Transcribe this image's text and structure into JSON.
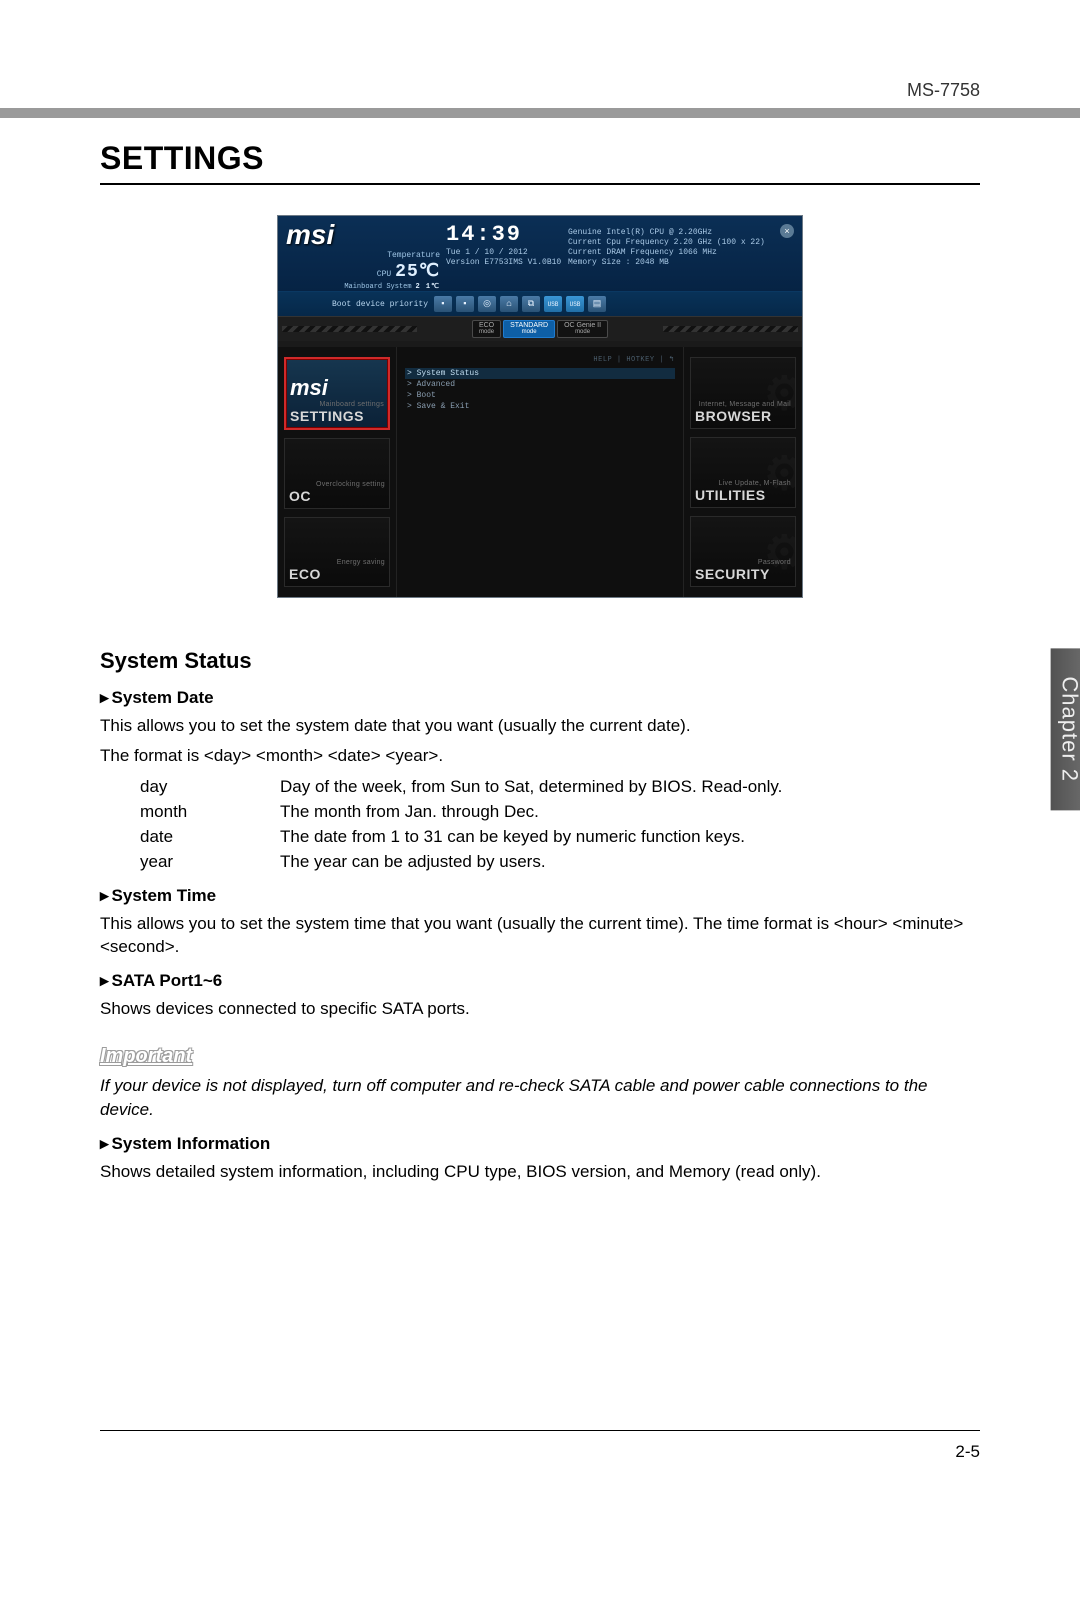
{
  "header": {
    "model": "MS-7758"
  },
  "page": {
    "title": "SETTINGS",
    "number": "2-5",
    "chapter": "Chapter 2"
  },
  "bios": {
    "logo": "msi",
    "temperature_label": "Temperature",
    "cpu_label": "CPU",
    "cpu_temp": "25℃",
    "mb_label": "Mainboard\nSystem",
    "mb_temp": "2 1℃",
    "clock": "14:39",
    "date": "Tue  1 / 10 / 2012",
    "version": "Version E7753IMS V1.0B10",
    "cpu_name": "Genuine Intel(R) CPU @ 2.20GHz",
    "cpu_freq": "Current Cpu Frequency 2.20 GHz (100 x 22)",
    "dram_freq": "Current DRAM Frequency 1066 MHz",
    "mem_size": "Memory Size : 2048 MB",
    "boot_label": "Boot device priority",
    "boot_icons": [
      "▪",
      "▪",
      "◎",
      "⌂",
      "⧉",
      "USB",
      "USB",
      "▤"
    ],
    "modes": [
      {
        "name": "ECO",
        "sub": "mode",
        "active": false
      },
      {
        "name": "STANDARD",
        "sub": "mode",
        "active": true
      },
      {
        "name": "OC Genie II",
        "sub": "mode",
        "active": false
      }
    ],
    "help_hotkey": "HELP  |  HOTKEY  |  ↰",
    "menu_items": [
      "> System Status",
      "> Advanced",
      "> Boot",
      "> Save & Exit"
    ],
    "left_tiles": [
      {
        "small": "Mainboard settings",
        "title": "SETTINGS",
        "logo": "msi",
        "selected": true
      },
      {
        "small": "Overclocking setting",
        "title": "OC",
        "selected": false
      },
      {
        "small": "Energy saving",
        "title": "ECO",
        "selected": false
      }
    ],
    "right_tiles": [
      {
        "small": "Internet,\nMessage and Mail",
        "title": "BROWSER"
      },
      {
        "small": "Live Update,\nM-Flash",
        "title": "UTILITIES"
      },
      {
        "small": "Password",
        "title": "SECURITY"
      }
    ]
  },
  "section1": {
    "title": "System Status",
    "f1_head": "System Date",
    "f1_body1": "This allows you to set the system date that you want (usually the current date).",
    "f1_body2": "The format is <day> <month> <date> <year>.",
    "defs": [
      {
        "term": "day",
        "desc": "Day of the week, from Sun to Sat, determined by BIOS. Read-only."
      },
      {
        "term": "month",
        "desc": "The month from Jan. through Dec."
      },
      {
        "term": "date",
        "desc": "The date from 1 to 31 can be keyed by numeric function keys."
      },
      {
        "term": "year",
        "desc": "The year can be adjusted by users."
      }
    ],
    "f2_head": "System Time",
    "f2_body": "This allows you to set the system time that you want (usually the current time). The time format is <hour> <minute> <second>.",
    "f3_head": "SATA Port1~6",
    "f3_body": "Shows devices connected to specific SATA ports.",
    "important_head": "Important",
    "important_body": "If your device is not displayed, turn off computer and re-check SATA cable and power cable connections to the device.",
    "f4_head": "System Information",
    "f4_body": "Shows detailed system information, including CPU type, BIOS version, and Memory (read only)."
  }
}
